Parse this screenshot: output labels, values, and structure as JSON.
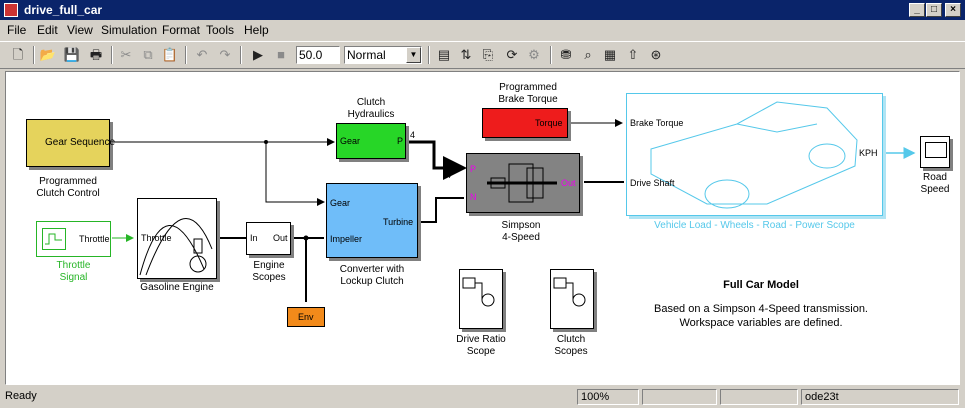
{
  "window": {
    "title": "drive_full_car"
  },
  "menu": [
    "File",
    "Edit",
    "View",
    "Simulation",
    "Format",
    "Tools",
    "Help"
  ],
  "toolbar": {
    "stop_time": "50.0",
    "sim_mode": "Normal"
  },
  "blocks": {
    "gear_sequence": {
      "label": "Gear Sequence",
      "caption1": "Programmed",
      "caption2": "Clutch Control"
    },
    "throttle_signal": {
      "port": "Throttle",
      "caption1": "Throttle",
      "caption2": "Signal"
    },
    "gasoline_engine": {
      "port_in": "Throttle",
      "caption": "Gasoline Engine"
    },
    "engine_scopes": {
      "in": "In",
      "out": "Out",
      "caption1": "Engine",
      "caption2": "Scopes"
    },
    "env": {
      "label": "Env"
    },
    "clutch_hydraulics": {
      "caption1": "Clutch",
      "caption2": "Hydraulics",
      "gear": "Gear",
      "p": "P",
      "signal": "4"
    },
    "converter": {
      "gear": "Gear",
      "impeller": "Impeller",
      "turbine": "Turbine",
      "caption1": "Converter with",
      "caption2": "Lockup Clutch"
    },
    "simpson": {
      "p": "P",
      "n": "N",
      "out": "Out",
      "caption1": "Simpson",
      "caption2": "4-Speed",
      "signal": "4"
    },
    "brake_torque": {
      "caption1": "Programmed",
      "caption2": "Brake Torque",
      "port": "Torque"
    },
    "vehicle": {
      "brake": "Brake Torque",
      "shaft": "Drive Shaft",
      "kph": "KPH",
      "caption": "Vehicle Load - Wheels - Road - Power Scope"
    },
    "road_speed": {
      "caption1": "Road",
      "caption2": "Speed"
    },
    "drive_ratio_scope": {
      "caption1": "Drive Ratio",
      "caption2": "Scope"
    },
    "clutch_scopes": {
      "caption1": "Clutch",
      "caption2": "Scopes"
    }
  },
  "annotation": {
    "title": "Full Car Model",
    "line1": "Based on a Simpson 4-Speed transmission.",
    "line2": "Workspace variables are defined."
  },
  "status": {
    "state": "Ready",
    "zoom": "100%",
    "solver": "ode23t"
  },
  "colors": {
    "gear_sequence": "#e5d35c",
    "clutch_hydraulics": "#27d627",
    "converter": "#6fbdf9",
    "simpson": "#838383",
    "brake_torque": "#ee1c1c",
    "env": "#f28a1a",
    "vehicle_line": "#55c8ea",
    "throttle_green": "#26b526"
  }
}
